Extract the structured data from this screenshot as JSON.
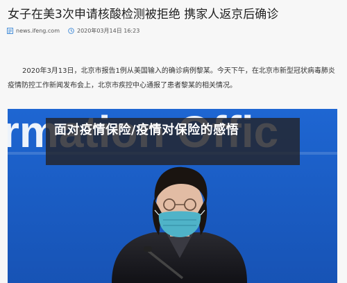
{
  "article": {
    "title": "女子在美3次申请核酸检测被拒绝 携家人返京后确诊",
    "source": "news.ifeng.com",
    "datetime": "2020年03月14日 16:23",
    "paragraph": "2020年3月13日，北京市报告1例从美国输入的确诊病例黎某。今天下午，在北京市新型冠状病毒肺炎疫情防控工作新闻发布会上，北京市疾控中心通报了患者黎某的相关情况。"
  },
  "photo": {
    "backdrop_text": "rmation Offic"
  },
  "banner": {
    "text": "面对疫情保险/疫情对保险的感悟"
  },
  "icons": {
    "source": "newspaper-icon",
    "datetime": "clock-icon"
  },
  "colors": {
    "backdrop_blue": "#1c60c8",
    "banner_bg": "#232328",
    "meta_icon": "#4a90d9"
  }
}
